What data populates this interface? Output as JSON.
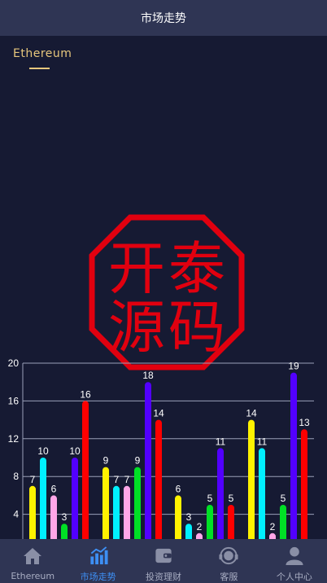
{
  "header": {
    "title": "市场走势"
  },
  "tabs": [
    {
      "label": "Ethereum",
      "active": true
    }
  ],
  "stamp": {
    "text": [
      "开",
      "泰",
      "源",
      "码"
    ],
    "color": "#e1000f"
  },
  "chart_data": {
    "type": "bar",
    "ylim": [
      0,
      20
    ],
    "yticks": [
      4,
      8,
      12,
      16,
      20
    ],
    "grid": true,
    "colors": [
      "#fff200",
      "#00f0ff",
      "#ffa6e8",
      "#00e025",
      "#5200ff",
      "#ff0000"
    ],
    "groups": [
      [
        7,
        10,
        6,
        3,
        10,
        16
      ],
      [
        9,
        7,
        7,
        9,
        18,
        14
      ],
      [
        6,
        3,
        2,
        5,
        11,
        5
      ],
      [
        14,
        11,
        2,
        5,
        19,
        13
      ]
    ]
  },
  "bottom_nav": [
    {
      "label": "Ethereum",
      "icon": "home-icon",
      "active": false
    },
    {
      "label": "市场走势",
      "icon": "bar-chart-icon",
      "active": true
    },
    {
      "label": "投资理财",
      "icon": "wallet-icon",
      "active": false
    },
    {
      "label": "客服",
      "icon": "headset-icon",
      "active": false
    },
    {
      "label": "个人中心",
      "icon": "user-icon",
      "active": false
    }
  ],
  "colors": {
    "accent": "#e7c77d",
    "active_nav": "#3d8ff4",
    "bar_bg": "#2f3554",
    "page_bg": "#161a33"
  }
}
